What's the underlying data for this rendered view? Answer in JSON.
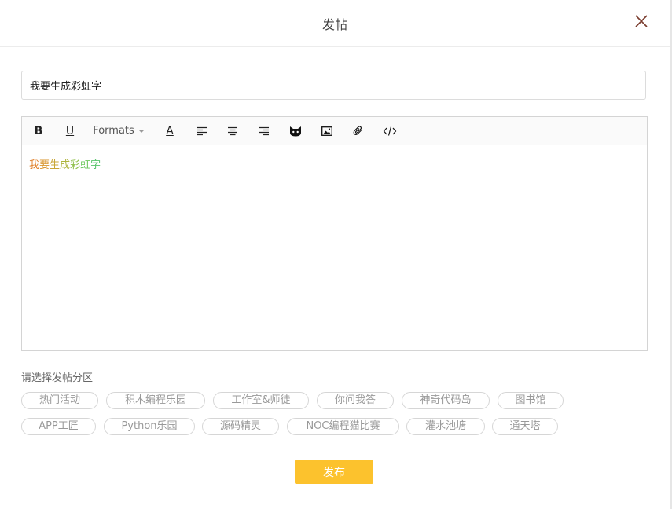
{
  "dialog": {
    "title": "发帖",
    "close_icon": "close-icon"
  },
  "post": {
    "title_value": "我要生成彩虹字",
    "body_text": "我要生成彩虹字"
  },
  "toolbar": {
    "bold_label": "B",
    "underline_label": "U",
    "formats_label": "Formats",
    "font_color_label": "A",
    "icons": [
      "align-left-icon",
      "align-center-icon",
      "align-right-icon",
      "cat-emoji-icon",
      "image-icon",
      "attachment-icon",
      "code-icon"
    ]
  },
  "rainbow_colors": [
    "#e0802a",
    "#d9962d",
    "#c8a535",
    "#aeb43c",
    "#8fc04a",
    "#6cc75c",
    "#57c46b"
  ],
  "section": {
    "label": "请选择发帖分区",
    "tags": [
      "热门活动",
      "积木编程乐园",
      "工作室&师徒",
      "你问我答",
      "神奇代码岛",
      "图书馆",
      "APP工匠",
      "Python乐园",
      "源码精灵",
      "NOC编程猫比赛",
      "灌水池塘",
      "通天塔"
    ]
  },
  "publish_button": {
    "label": "发布",
    "color": "#fcc22d"
  }
}
